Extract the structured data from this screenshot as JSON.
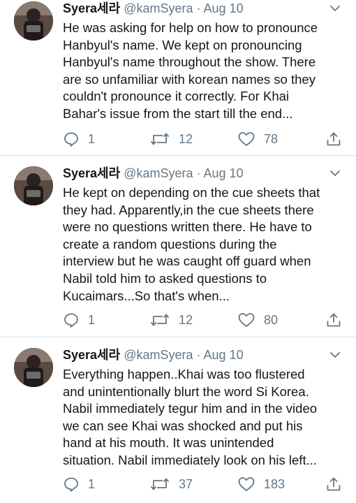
{
  "tweets": [
    {
      "name": "Syera세라",
      "handle": "@kamSyera",
      "separator": "·",
      "date": "Aug 10",
      "lines": [
        "He was asking for help on how to pronounce",
        "Hanbyul's name. We kept on pronouncing",
        "Hanbyul's name throughout the show. There",
        "are so unfamiliar with korean names so they",
        "couldn't pronounce it correctly. For Khai",
        "Bahar's issue from the start till the end..."
      ],
      "replies": "1",
      "retweets": "12",
      "likes": "78"
    },
    {
      "name": "Syera세라",
      "handle": "@kamSyera",
      "separator": "·",
      "date": "Aug 10",
      "lines": [
        "He kept on depending on the cue sheets that",
        "they had. Apparently,in the cue sheets there",
        "were no questions written there. He have to",
        "create a random questions during the",
        "interview but he was caught off guard when",
        "Nabil told him to asked questions to",
        "Kucaimars...So that's when..."
      ],
      "replies": "1",
      "retweets": "12",
      "likes": "80"
    },
    {
      "name": "Syera세라",
      "handle": "@kamSyera",
      "separator": "·",
      "date": "Aug 10",
      "lines": [
        "Everything happen..Khai was too flustered",
        "and unintentionally blurt the word Si Korea.",
        "Nabil immediately tegur him and in the video",
        "we can see Khai was shocked and put his",
        "hand at his mouth. It was unintended",
        "situation. Nabil immediately look on his left..."
      ],
      "replies": "1",
      "retweets": "37",
      "likes": "183"
    }
  ],
  "colors": {
    "text": "#14171a",
    "secondary": "#657786",
    "divider": "#d8dde1"
  }
}
